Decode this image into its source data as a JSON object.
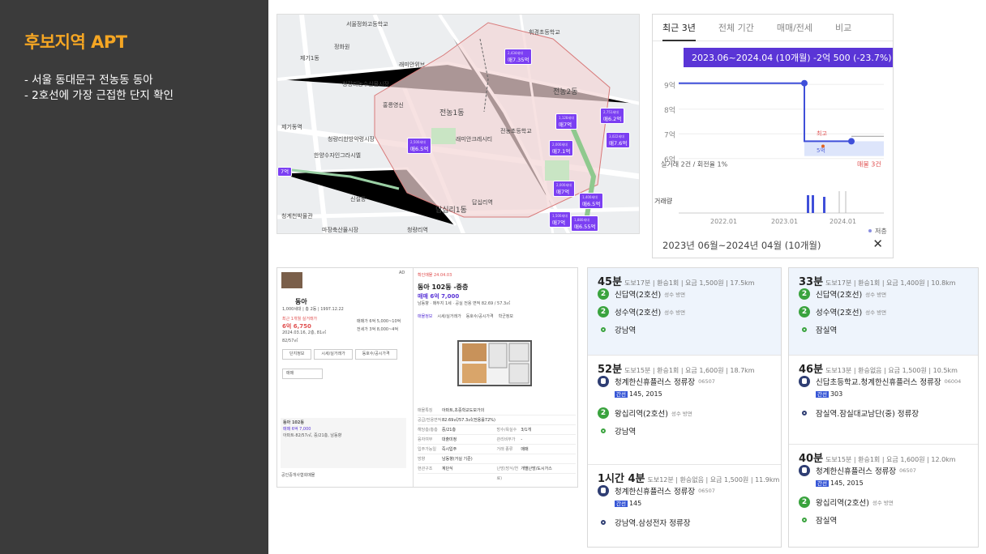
{
  "slide": {
    "title": "후보지역 APT",
    "lines": [
      "- 서울 동대문구 전농동 동아",
      "- 2호선에 가장 근접한 단지 확인"
    ]
  },
  "map": {
    "labels": [
      "제기동",
      "서울정화고등학교",
      "정화원",
      "제기1동",
      "제기동주민센터",
      "청량리농수산물시장",
      "제기동역",
      "청량리한방약령시장",
      "한양수자인그라시엘",
      "홍릉영신",
      "신설동",
      "정원당",
      "망우고가차도",
      "답십리1동",
      "청계천박물관",
      "마장축산물시장",
      "청량리역",
      "전농2동",
      "전농1동",
      "답십리역",
      "전농초등학교",
      "휘경초등학교",
      "신답역",
      "답십리이동",
      "전농동",
      "래미안크레시티",
      "청량리역롯데캐슬",
      "래미안위브",
      "고등학교",
      "전농동사거리"
    ],
    "tags": [
      {
        "price": "매7.35억",
        "n": "2,434세대"
      },
      {
        "price": "매6.5억",
        "n": "2,500세대"
      },
      {
        "price": "매7억",
        "n": "1,128세대"
      },
      {
        "price": "매7.1억",
        "n": "2,000세대"
      },
      {
        "price": "매6.2억",
        "n": "2,751세대"
      },
      {
        "price": "매7.6억",
        "n": "3,022세대"
      },
      {
        "price": "매7억",
        "n": "2,000세대"
      },
      {
        "price": "매6.5억",
        "n": "1,400세대"
      },
      {
        "price": "매7억",
        "n": "1,500세대"
      },
      {
        "price": "매6.55억",
        "n": "1,880세대"
      },
      {
        "price": "7억",
        "n": ""
      }
    ]
  },
  "chart_panel": {
    "tabs": [
      "최근 3년",
      "전체 기간",
      "매매/전세",
      "비교"
    ],
    "tooltip": "2023.06~2024.04 (10개월)  -2억 500 (-23.7%)",
    "yticks": [
      "9억",
      "8억",
      "7억",
      "6억"
    ],
    "xticks": [
      "2022.01",
      "2023.01",
      "2024.01"
    ],
    "volume_label": "거래량",
    "note": "실거래 2건 / 회전율 1%",
    "note_right": "매물 3건",
    "low_label": "최고",
    "low_val": "5억",
    "legend": "저층",
    "footer": "2023년 06월~2024년 04월 (10개월)",
    "close": "✕"
  },
  "chart_data": {
    "type": "line",
    "x": [
      "2022.01",
      "2022.06",
      "2023.01",
      "2023.06",
      "2023.10",
      "2024.01",
      "2024.04"
    ],
    "values": [
      9.1,
      9.1,
      9.1,
      9.0,
      6.7,
      6.7,
      6.9
    ],
    "ylim": [
      5.5,
      9.5
    ],
    "xlabel": "",
    "ylabel": ""
  },
  "detail": {
    "ad": "AD",
    "left": {
      "title": "동아",
      "sub": "1,000세대 | 총 2동 | 1997.12.22",
      "r1": "최근 1개월 실거래가",
      "price": "6억 6,750",
      "date": "2024.03.16, 2층, 81㎡",
      "buy": "매매가 6억 5,000~10억",
      "rent": "전세가 3억 8,000~4억",
      "m2": "82/57㎡",
      "buttons": [
        "단지정보",
        "시세/실거래가",
        "동호수/공시가격"
      ],
      "filter": "매매",
      "item_title": "동아 102동",
      "item_price": "매매 6억 7,000",
      "item_desc": "아파트·82/57㎡, 중/21층, 남동향",
      "btn": "공인중개사협회매물"
    },
    "right": {
      "head": "확인매물 24.04.03",
      "title": "동아 102동 -중층",
      "price": "매매 6억 7,000",
      "desc": "남동향 · 매두지 1세 · 공실 전용 면적 82.69 / 57.3㎡",
      "tabs": [
        "매물정보",
        "시세/실거래가",
        "동호수/공시가격",
        "학군정보"
      ],
      "rows": [
        [
          "매물특징",
          "아파트,초중학교도보가의"
        ],
        [
          "공급/전용면적",
          "82.69㎡/57.3㎡(전용률72%)"
        ],
        [
          "해당층/총층",
          "중/21층",
          "방수/욕실수",
          "3/1개"
        ],
        [
          "융자여부",
          "대출미정",
          "관리비부가",
          "-"
        ],
        [
          "입주가능일",
          "즉시입주",
          "거래 종류",
          "매매"
        ],
        [
          "방향",
          "남동향(거실 기준)"
        ],
        [
          "현관구조",
          "계단식",
          "난방(방식/연료)",
          "개별난방/도시가스"
        ]
      ]
    }
  },
  "transit": {
    "routes": [
      {
        "time": "45분",
        "meta": "도보17분 | 환승1회 | 요금 1,500원 | 17.5km",
        "stops": [
          {
            "t": "subway",
            "n": "2",
            "name": "신답역(2호선)",
            "dir": "성수 방면"
          },
          {
            "t": "subway",
            "n": "2",
            "name": "성수역(2호선)",
            "dir": "성수 방면"
          },
          {
            "t": "end",
            "name": "강남역"
          }
        ]
      },
      {
        "time": "52분",
        "meta": "도보15분 | 환승1회 | 요금 1,600원 | 18.7km",
        "stops": [
          {
            "t": "bus",
            "name": "청계한신휴플러스 정류장",
            "dir": "06507",
            "lines": "145, 2015"
          },
          {
            "t": "subway",
            "n": "2",
            "name": "왕십리역(2호선)",
            "dir": "성수 방면"
          },
          {
            "t": "end",
            "name": "강남역"
          }
        ]
      },
      {
        "time": "1시간 4분",
        "meta": "도보12분 | 환승없음 | 요금 1,500원 | 11.9km",
        "stops": [
          {
            "t": "bus",
            "name": "청계한신휴플러스 정류장",
            "dir": "06507",
            "lines": "145"
          },
          {
            "t": "end",
            "name": "강남역.삼성전자 정류장"
          }
        ]
      },
      {
        "time": "33분",
        "meta": "도보17분 | 환승1회 | 요금 1,400원 | 10.8km",
        "stops": [
          {
            "t": "subway",
            "n": "2",
            "name": "신답역(2호선)",
            "dir": "성수 방면"
          },
          {
            "t": "subway",
            "n": "2",
            "name": "성수역(2호선)",
            "dir": "성수 방면"
          },
          {
            "t": "end",
            "name": "잠실역"
          }
        ]
      },
      {
        "time": "46분",
        "meta": "도보13분 | 환승없음 | 요금 1,500원 | 10.5km",
        "stops": [
          {
            "t": "bus",
            "name": "신답초등학교.청계한신휴플러스 정류장",
            "dir": "06004",
            "lines": "303"
          },
          {
            "t": "end",
            "name": "잠실역.잠실대교남단(중) 정류장"
          }
        ]
      },
      {
        "time": "40분",
        "meta": "도보15분 | 환승1회 | 요금 1,600원 | 12.0km",
        "stops": [
          {
            "t": "bus",
            "name": "청계한신휴플러스 정류장",
            "dir": "06507",
            "lines": "145, 2015"
          },
          {
            "t": "subway",
            "n": "2",
            "name": "왕십리역(2호선)",
            "dir": "성수 방면"
          },
          {
            "t": "end",
            "name": "잠실역"
          }
        ]
      }
    ],
    "bus_badge": "간선",
    "bus_badge2": "지선"
  }
}
